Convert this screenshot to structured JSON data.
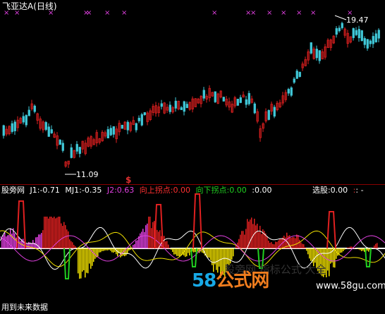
{
  "title_bar": {
    "name": "飞亚达A",
    "period": "(日线)"
  },
  "price_chart": {
    "high_label": "19.47",
    "low_label": "11.09",
    "signal_symbol": "$"
  },
  "indicator_bar": {
    "name": "股旁网",
    "j1_label": "J1:",
    "j1_value": "-0.71",
    "mj1_label": "MJ1:",
    "mj1_value": "-0.35",
    "j2_label": "J2:",
    "j2_value": "0.63",
    "up_label": "向上拐点:",
    "up_value": "0.00",
    "down_label": "向下拐点:",
    "down_value": "0.00",
    "extra_label": ":",
    "extra_value": "0.00",
    "select_label": "选股:",
    "select_value": "0.00",
    "tail_label": ":",
    "tail_tail": ": -"
  },
  "watermark": {
    "brand_num": "58",
    "brand_cn": "公式网",
    "site": "www.58gu.com",
    "mid_text": "股旁网  指标公式  大全"
  },
  "footer": {
    "text": "用到未来数据"
  },
  "colors": {
    "up": "#e02020",
    "down": "#40c8d8",
    "magenta": "#e040e0",
    "yellow": "#f0e000",
    "green": "#20d020",
    "white": "#ffffff",
    "red_line": "#e02020"
  }
}
